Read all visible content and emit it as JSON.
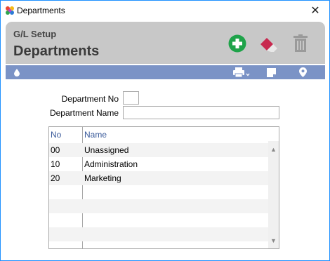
{
  "window": {
    "title": "Departments"
  },
  "header": {
    "crumb": "G/L Setup",
    "title": "Departments"
  },
  "colors": {
    "accent_bar": "#7b93c6",
    "add_green": "#1fa34a",
    "header_bg": "#c8c8c8",
    "window_border": "#1e90ff"
  },
  "icons": {
    "add": "plus-circle-icon",
    "clear": "eraser-icon",
    "delete": "trash-icon",
    "filter": "drop-icon",
    "print": "printer-icon",
    "note": "note-icon",
    "location": "location-pin-icon"
  },
  "form": {
    "dept_no_label": "Department No",
    "dept_no_value": "",
    "dept_name_label": "Department Name",
    "dept_name_value": ""
  },
  "grid": {
    "columns": [
      "No",
      "Name"
    ],
    "rows": [
      {
        "no": "00",
        "name": "Unassigned"
      },
      {
        "no": "10",
        "name": "Administration"
      },
      {
        "no": "20",
        "name": "Marketing"
      }
    ]
  }
}
